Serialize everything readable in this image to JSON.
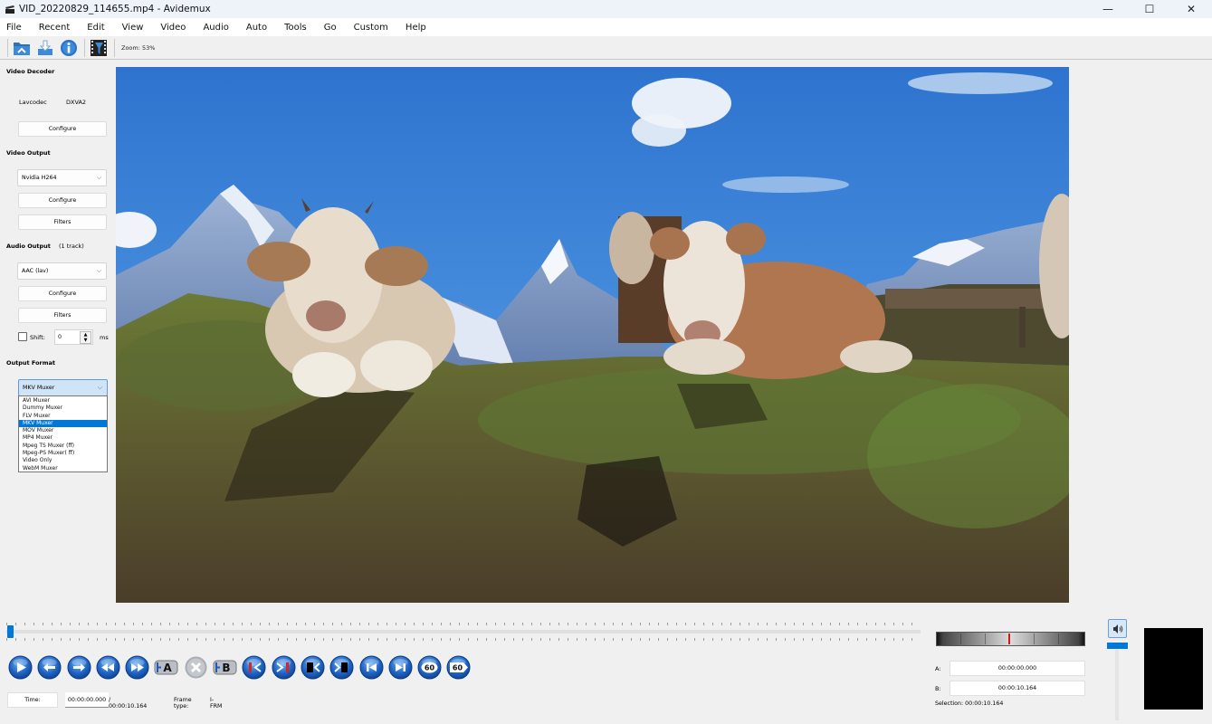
{
  "window": {
    "title": "VID_20220829_114655.mp4 - Avidemux",
    "controls": {
      "minimize": "—",
      "maximize": "☐",
      "close": "✕"
    }
  },
  "menu": [
    "File",
    "Recent",
    "Edit",
    "View",
    "Video",
    "Audio",
    "Auto",
    "Tools",
    "Go",
    "Custom",
    "Help"
  ],
  "toolbar": {
    "buttons": [
      {
        "name": "open-file",
        "icon": "open-folder-icon"
      },
      {
        "name": "save-file",
        "icon": "save-download-icon"
      },
      {
        "name": "properties",
        "icon": "info-icon"
      },
      {
        "name": "filters",
        "icon": "film-filter-icon"
      }
    ],
    "zoom_label": "Zoom: 53%"
  },
  "left_panel": {
    "video_decoder": {
      "title": "Video Decoder",
      "decoder_name": "Lavcodec",
      "hw_accel": "DXVA2",
      "configure_label": "Configure"
    },
    "video_output": {
      "title": "Video Output",
      "codec_selected": "Nvidia H264",
      "configure_label": "Configure",
      "filters_label": "Filters"
    },
    "audio_output": {
      "title": "Audio Output",
      "tracks": "(1 track)",
      "codec_selected": "AAC (lav)",
      "configure_label": "Configure",
      "filters_label": "Filters",
      "shift_label": "Shift:",
      "shift_checked": false,
      "shift_value": "0",
      "shift_unit": "ms"
    },
    "output_format": {
      "title": "Output Format",
      "selected": "MKV Muxer",
      "options": [
        "AVI Muxer",
        "Dummy Muxer",
        "FLV Muxer",
        "MKV Muxer",
        "MOV Muxer",
        "MP4 Muxer",
        "Mpeg TS Muxer (ff)",
        "Mpeg-PS Muxer( ff)",
        "Video Only",
        "WebM Muxer"
      ],
      "highlighted_index": 3
    }
  },
  "timeline": {
    "position_fraction": 0.0
  },
  "playback_controls": [
    {
      "name": "play",
      "icon": "play-icon"
    },
    {
      "name": "previous-frame",
      "icon": "arrow-left-icon"
    },
    {
      "name": "next-frame",
      "icon": "arrow-right-icon"
    },
    {
      "name": "previous-keyframe",
      "icon": "rewind-icon"
    },
    {
      "name": "next-keyframe",
      "icon": "fast-forward-icon"
    },
    {
      "name": "set-marker-a",
      "icon": "marker-a-icon",
      "label": "A"
    },
    {
      "name": "delete-selection",
      "icon": "close-circle-icon"
    },
    {
      "name": "set-marker-b",
      "icon": "marker-b-icon",
      "label": "B"
    },
    {
      "name": "goto-marker-a",
      "icon": "goto-marker-a-icon"
    },
    {
      "name": "goto-marker-b",
      "icon": "goto-marker-b-icon"
    },
    {
      "name": "previous-black-frame",
      "icon": "prev-black-frame-icon"
    },
    {
      "name": "next-black-frame",
      "icon": "next-black-frame-icon"
    },
    {
      "name": "goto-first-frame",
      "icon": "skip-start-icon"
    },
    {
      "name": "goto-last-frame",
      "icon": "skip-end-icon"
    },
    {
      "name": "back-60s",
      "icon": "back-60-icon",
      "label": "60"
    },
    {
      "name": "forward-60s",
      "icon": "forward-60-icon",
      "label": "60"
    }
  ],
  "status": {
    "time_label": "Time:",
    "current_time": "00:00:00.000",
    "total_time": "/ 00:00:10.164",
    "frame_type_label": "Frame type:",
    "frame_type": "I-FRM"
  },
  "selection": {
    "a_label": "A:",
    "a_value": "00:00:00.000",
    "b_label": "B:",
    "b_value": "00:00:10.164",
    "selection_text": "Selection: 00:00:10.164"
  },
  "volume": {
    "icon": "speaker-icon",
    "level_fraction": 1.0
  },
  "colors": {
    "accent": "#0078d7",
    "jog_marker": "#d21a1a"
  }
}
